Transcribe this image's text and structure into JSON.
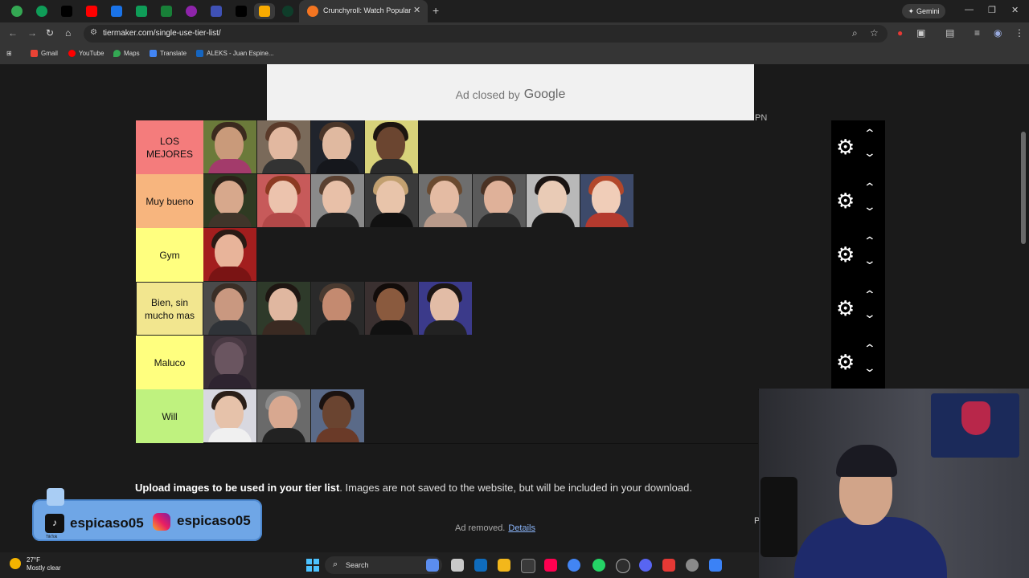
{
  "browser": {
    "pinned_tab_colors": [
      "#34a853",
      "#0f9d58",
      "#000000",
      "#ff0000",
      "#1a73e8",
      "#0f9d58",
      "#188038",
      "#8e24aa",
      "#3f51b5",
      "#000000",
      "#f9ab00",
      "#0f9d58"
    ],
    "active_tab_title": "Crunchyroll: Watch Popular Ani",
    "close_tab": "✕",
    "new_tab": "+",
    "gemini_label": "Gemini",
    "url": "tiermaker.com/single-use-tier-list/",
    "bookmarks": [
      {
        "label": "Gmail",
        "color": "#ea4335"
      },
      {
        "label": "YouTube",
        "color": "#ff0000"
      },
      {
        "label": "Maps",
        "color": "#34a853"
      },
      {
        "label": "Translate",
        "color": "#4285f4"
      },
      {
        "label": "ALEKS - Juan Espine...",
        "color": "#1565c0"
      }
    ]
  },
  "page": {
    "ad_top_text": "Ad closed by",
    "ad_top_brand": "Google",
    "pn_text": "PN",
    "tiers": [
      {
        "label": "LOS MEJORES",
        "color": "#f47c7c",
        "count": 4
      },
      {
        "label": "Muy bueno",
        "color": "#f7b57e",
        "count": 8
      },
      {
        "label": "Gym",
        "color": "#ffff7f",
        "count": 1
      },
      {
        "label": "Bien, sin mucho mas",
        "color": "#f2e68f",
        "count": 5
      },
      {
        "label": "Maluco",
        "color": "#ffff7f",
        "count": 1
      },
      {
        "label": "Will",
        "color": "#bff27f",
        "count": 3
      }
    ],
    "upload_bold": "Upload images to be used in your tier list",
    "upload_rest": ". Images are not saved to the website, but will be included in your download.",
    "ad_removed": "Ad removed.",
    "details_link": "Details",
    "p_letter": "P"
  },
  "overlay": {
    "tiktok_handle": "espicaso05",
    "tiktok_label": "TikTok",
    "instagram_handle": "espicaso05"
  },
  "taskbar": {
    "temperature": "27°F",
    "condition": "Mostly clear",
    "search_label": "Search",
    "app_colors": [
      "#5b8def",
      "#c9c9c9",
      "#0f6cbd",
      "#f3b71b",
      "#3a3a3a",
      "#ff0050",
      "#4285f4",
      "#25d366",
      "#2e2e2e",
      "#5865f2",
      "#e53935",
      "#8a8a8a",
      "#3b82f6"
    ]
  }
}
